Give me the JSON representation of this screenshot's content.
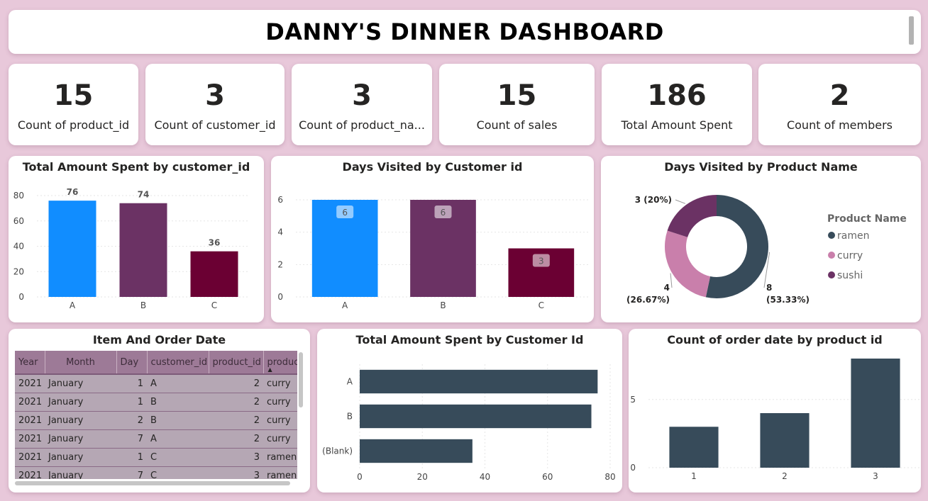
{
  "header": {
    "title": "DANNY'S DINNER DASHBOARD"
  },
  "kpis": [
    {
      "value": "15",
      "label": "Count of product_id"
    },
    {
      "value": "3",
      "label": "Count of customer_id"
    },
    {
      "value": "3",
      "label": "Count of product_na..."
    },
    {
      "value": "15",
      "label": "Count of sales"
    },
    {
      "value": "186",
      "label": "Total Amount Spent"
    },
    {
      "value": "2",
      "label": "Count of members"
    }
  ],
  "table": {
    "title": "Item And Order Date",
    "columns": [
      "Year",
      "Month",
      "Day",
      "customer_id",
      "product_id",
      "product_name"
    ],
    "rows": [
      [
        "2021",
        "January",
        "1",
        "A",
        "2",
        "curry"
      ],
      [
        "2021",
        "January",
        "1",
        "B",
        "2",
        "curry"
      ],
      [
        "2021",
        "January",
        "2",
        "B",
        "2",
        "curry"
      ],
      [
        "2021",
        "January",
        "7",
        "A",
        "2",
        "curry"
      ],
      [
        "2021",
        "January",
        "1",
        "C",
        "3",
        "ramen"
      ],
      [
        "2021",
        "January",
        "7",
        "C",
        "3",
        "ramen"
      ]
    ]
  },
  "chart_data": [
    {
      "type": "bar",
      "title": "Total Amount Spent by customer_id",
      "categories": [
        "A",
        "B",
        "C"
      ],
      "values": [
        76,
        74,
        36
      ],
      "colors": [
        "#118dff",
        "#6b3264",
        "#6b0033"
      ],
      "ylim": [
        0,
        80
      ],
      "yticks": [
        0,
        20,
        40,
        60,
        80
      ],
      "grid": true
    },
    {
      "type": "bar",
      "title": "Days Visited by Customer id",
      "categories": [
        "A",
        "B",
        "C"
      ],
      "values": [
        6,
        6,
        3
      ],
      "colors": [
        "#118dff",
        "#6b3264",
        "#6b0033"
      ],
      "ylim": [
        0,
        6
      ],
      "yticks": [
        0,
        2,
        4,
        6
      ],
      "grid": true
    },
    {
      "type": "pie",
      "title": "Days Visited by Product Name",
      "legend_title": "Product Name",
      "legend_position": "right",
      "labels": [
        "ramen",
        "curry",
        "sushi"
      ],
      "values": [
        8,
        4,
        3
      ],
      "percent_labels": [
        "(53.33%)",
        "(26.67%)",
        "(20%)"
      ],
      "colors": [
        "#374b5a",
        "#c97fab",
        "#6b3264"
      ]
    },
    {
      "type": "bar",
      "orientation": "horizontal",
      "title": "Total Amount Spent by Customer Id",
      "categories": [
        "A",
        "B",
        "(Blank)"
      ],
      "values": [
        76,
        74,
        36
      ],
      "color": "#374b5a",
      "xlim": [
        0,
        80
      ],
      "xticks": [
        0,
        20,
        40,
        60,
        80
      ],
      "grid": true
    },
    {
      "type": "bar",
      "title": "Count of order date by product id",
      "categories": [
        "1",
        "2",
        "3"
      ],
      "values": [
        3,
        4,
        8
      ],
      "color": "#374b5a",
      "ylim": [
        0,
        8
      ],
      "yticks": [
        0,
        5
      ],
      "grid": true
    }
  ]
}
